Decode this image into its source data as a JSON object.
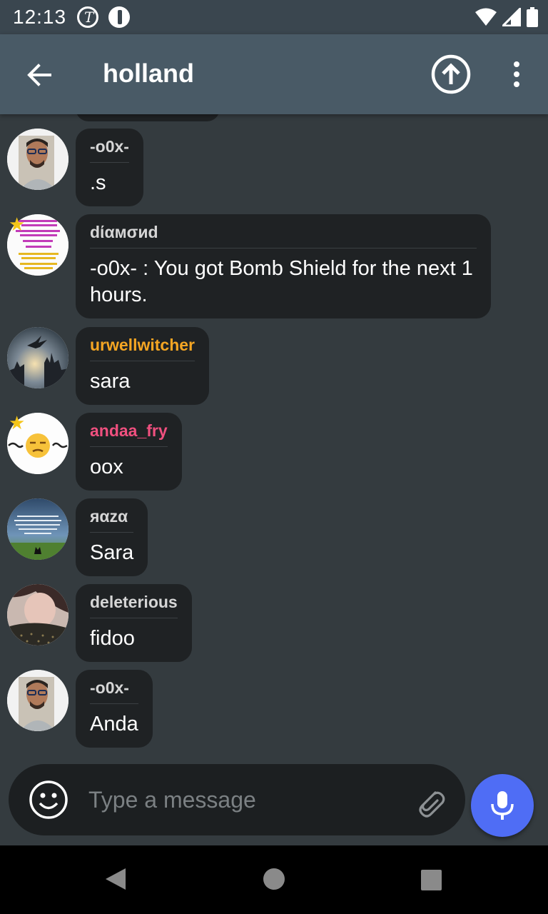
{
  "status_bar": {
    "time": "12:13"
  },
  "app_bar": {
    "title": "holland"
  },
  "colors": {
    "app_bar": "#495a66",
    "status_bar": "#3a464f",
    "background": "#343b3f",
    "bubble": "#1f2224",
    "mic_button": "#4f6df5",
    "sender_default": "#d6d6d6",
    "sender_orange": "#f5a623",
    "sender_pink": "#f0507f"
  },
  "messages": [
    {
      "sender": "-o0x-",
      "text": ".s",
      "sender_color": "#d6d6d6",
      "avatar": "man-with-glasses"
    },
    {
      "sender": "dίαмσиd",
      "text": "-o0x- : You got Bomb Shield for the next 1 hours.",
      "sender_color": "#d6d6d6",
      "avatar": "info-poster",
      "star": true
    },
    {
      "sender": "urwellwitcher",
      "text": "sara",
      "sender_color": "#f5a623",
      "avatar": "dragon-castle"
    },
    {
      "sender": "andaa_fry",
      "text": "oox",
      "sender_color": "#f0507f",
      "avatar": "unamused-emoji",
      "star": true
    },
    {
      "sender": "яαzα",
      "text": "Sara",
      "sender_color": "#d6d6d6",
      "avatar": "quote-landscape"
    },
    {
      "sender": "deleterious",
      "text": "fidoo",
      "sender_color": "#d6d6d6",
      "avatar": "person-photo"
    },
    {
      "sender": "-o0x-",
      "text": "Anda",
      "sender_color": "#d6d6d6",
      "avatar": "man-with-glasses"
    }
  ],
  "composer": {
    "placeholder": "Type a message"
  },
  "icons": {
    "back": "arrow-left-icon",
    "upload": "arrow-up-circle-icon",
    "more": "more-vert-icon",
    "emoji": "smiley-icon",
    "attach": "paperclip-icon",
    "mic": "microphone-icon"
  }
}
